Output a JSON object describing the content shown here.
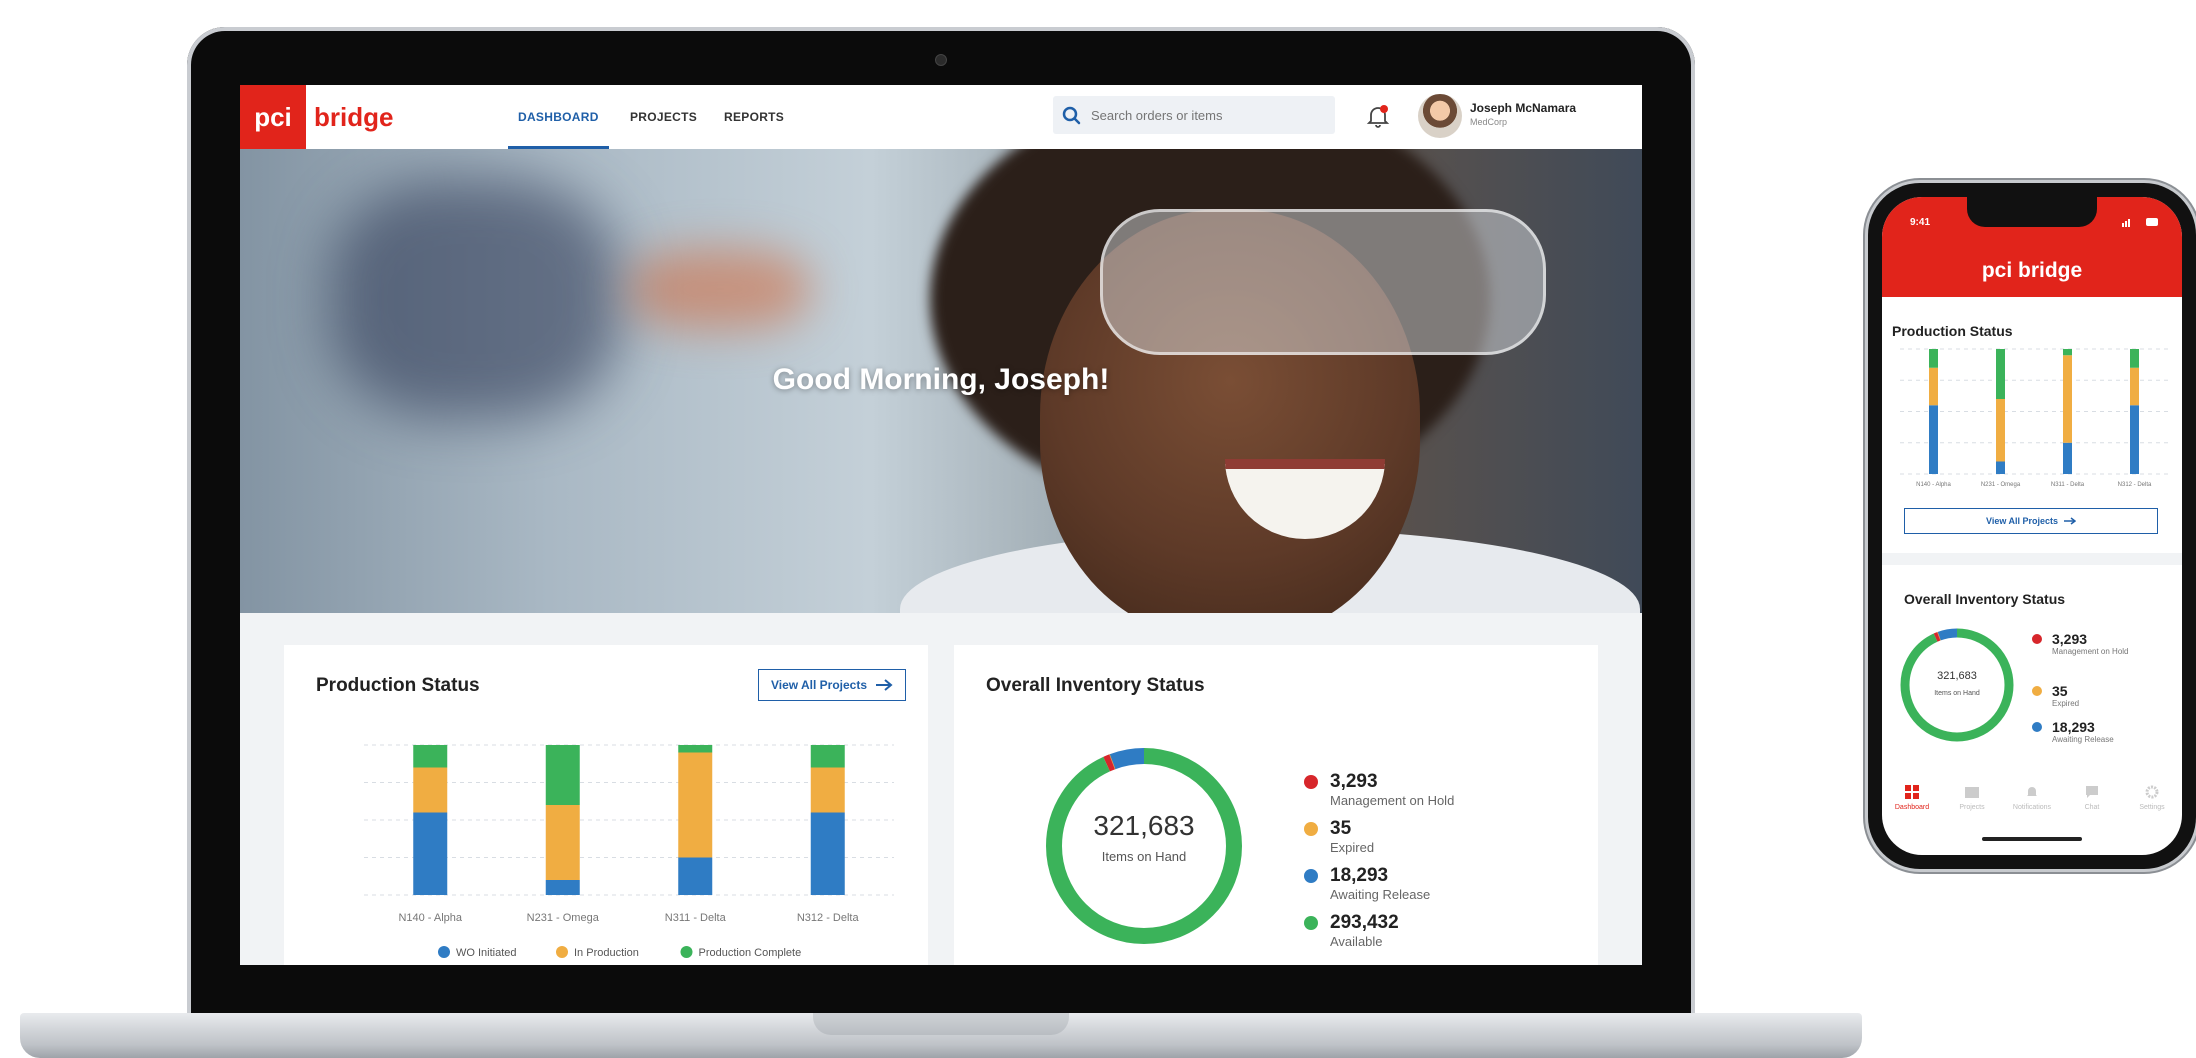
{
  "brand": {
    "pci": "pci",
    "bridge": "bridge",
    "color": "#e1241b",
    "accent": "#1f5fa8"
  },
  "nav": {
    "tabs": [
      {
        "label": "DASHBOARD",
        "active": true
      },
      {
        "label": "PROJECTS",
        "active": false
      },
      {
        "label": "REPORTS",
        "active": false
      }
    ],
    "search_placeholder": "Search orders or items",
    "user": {
      "name": "Joseph McNamara",
      "org": "MedCorp"
    }
  },
  "hero": {
    "greeting": "Good Morning, Joseph!"
  },
  "production": {
    "title": "Production Status",
    "button": "View All Projects"
  },
  "inventory": {
    "title": "Overall Inventory Status",
    "total": "321,683",
    "total_label": "Items on Hand",
    "items": [
      {
        "value": "3,293",
        "label": "Management on Hold",
        "color": "#d7262b"
      },
      {
        "value": "35",
        "label": "Expired",
        "color": "#f0ad42"
      },
      {
        "value": "18,293",
        "label": "Awaiting Release",
        "color": "#2f7cc4"
      },
      {
        "value": "293,432",
        "label": "Available",
        "color": "#3bb35a"
      }
    ]
  },
  "chart_data": [
    {
      "type": "bar",
      "stacked": true,
      "title": "Production Status",
      "categories": [
        "N140 - Alpha",
        "N231 - Omega",
        "N311 - Delta",
        "N312 - Delta"
      ],
      "series": [
        {
          "name": "WO Initiated",
          "color": "#2f7cc4",
          "values": [
            55,
            10,
            25,
            55
          ]
        },
        {
          "name": "In Production",
          "color": "#f0ad42",
          "values": [
            30,
            50,
            70,
            30
          ]
        },
        {
          "name": "Production Complete",
          "color": "#3bb35a",
          "values": [
            15,
            40,
            5,
            15
          ]
        }
      ],
      "ylim": [
        0,
        100
      ],
      "grid": true,
      "legend_position": "bottom"
    },
    {
      "type": "pie",
      "donut": true,
      "title": "Overall Inventory Status",
      "labels": [
        "Management on Hold",
        "Expired",
        "Awaiting Release",
        "Available"
      ],
      "values": [
        3293,
        35,
        18293,
        293432
      ],
      "colors": [
        "#d7262b",
        "#f0ad42",
        "#2f7cc4",
        "#3bb35a"
      ]
    }
  ],
  "phone": {
    "time": "9:41",
    "tabs": [
      "Dashboard",
      "Projects",
      "Notifications",
      "Chat",
      "Settings"
    ]
  }
}
